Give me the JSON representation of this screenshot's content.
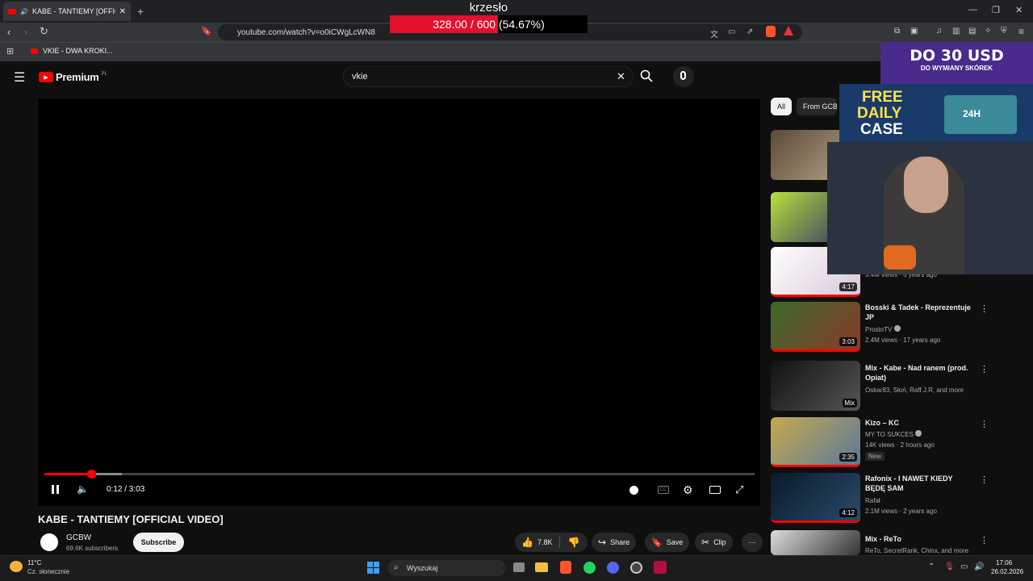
{
  "browser": {
    "tab_title": "KABE - TANTIEMY [OFFICIAL V",
    "url": "youtube.com/watch?v=o0iCWgLcWN8",
    "bookmark": "VKIE - DWA KROKI..."
  },
  "goal": {
    "title": "krzesło",
    "text": "328.00 / 600 (54.67%)",
    "progress": 0.5467
  },
  "youtube": {
    "logo": "Premium",
    "logo_badge": "PL",
    "search_value": "vkie"
  },
  "player": {
    "time": "0:12 / 3:03",
    "progress": 0.066
  },
  "video": {
    "title": "KABE - TANTIEMY [OFFICIAL VIDEO]",
    "channel": "GCBW",
    "subscribers": "69.6K subscribers",
    "subscribe_label": "Subscribe",
    "likes": "7.8K",
    "share_label": "Share",
    "save_label": "Save",
    "clip_label": "Clip"
  },
  "chips": [
    "All",
    "From GCBW"
  ],
  "related": [
    {
      "partial_meta": "3.4M views · 6 years ago",
      "duration": "4:17"
    },
    {
      "title": "Bosski & Tadek - Reprezentuje JP",
      "channel": "ProstoTV",
      "meta": "2.4M views · 17 years ago",
      "duration": "3:03"
    },
    {
      "title": "Mix - Kabe - Nad ranem (prod. Opiat)",
      "channel": "Oskar83, Słoń, Raff J.R, and more",
      "duration": "Mix"
    },
    {
      "title": "Kizo – KC",
      "channel": "MY TO SUKCES",
      "meta": "14K views · 2 hours ago",
      "badge": "New",
      "duration": "2:35"
    },
    {
      "title": "Rafonix - I NAWET KIEDY BĘDĘ SAM",
      "channel": "Rafał",
      "meta": "2.1M views · 2 years ago",
      "duration": "4:12"
    },
    {
      "title": "Mix - ReTo",
      "channel": "ReTo, SecretRank, Chinx, and more"
    }
  ],
  "ads": {
    "ad1_line1": "DO 30 USD",
    "ad1_line2": "DO WYMIANY SKÓREK",
    "ad2_line1": "FREE",
    "ad2_line2": "DAILY",
    "ad2_line3": "CASE",
    "ad2_badge": "24H"
  },
  "taskbar": {
    "temp": "11°C",
    "weather": "Cz. słonecznie",
    "search": "Wyszukaj",
    "time": "17:06",
    "date": "26.02.2026"
  }
}
